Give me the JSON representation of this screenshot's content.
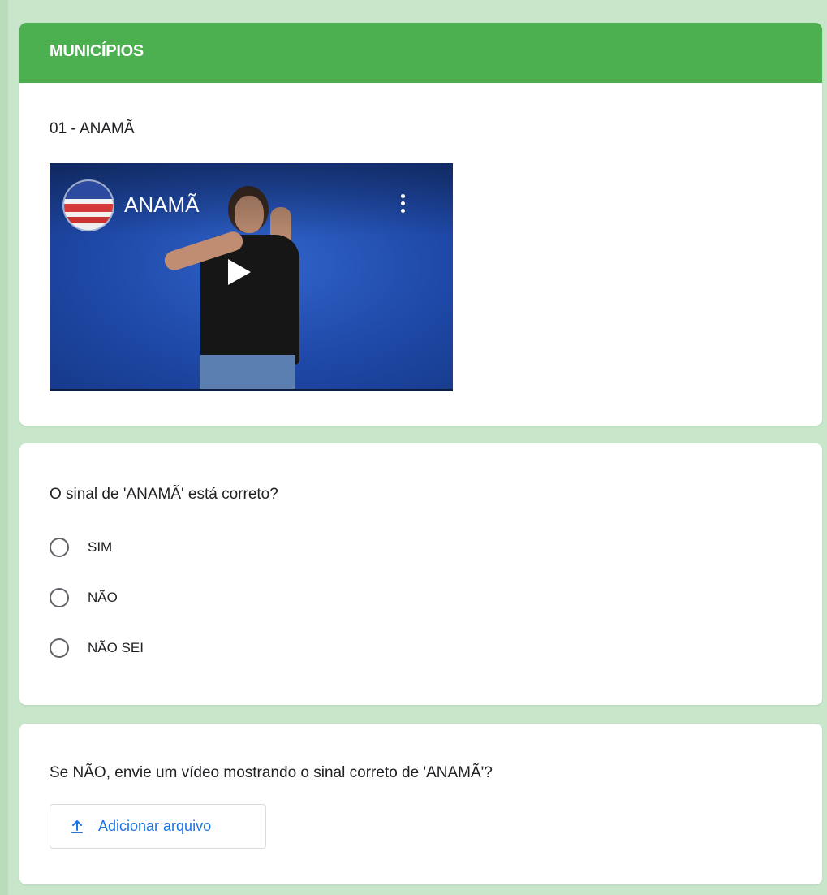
{
  "section": {
    "title": "MUNICÍPIOS",
    "item_title": "01 - ANAMÃ",
    "video": {
      "title": "ANAMÃ"
    }
  },
  "question": {
    "text": "O sinal de 'ANAMÃ' está correto?",
    "options": [
      {
        "label": "SIM",
        "selected": false
      },
      {
        "label": "NÃO",
        "selected": false
      },
      {
        "label": "NÃO SEI",
        "selected": false
      }
    ]
  },
  "upload": {
    "question": "Se NÃO, envie um vídeo mostrando o sinal correto de 'ANAMÃ'?",
    "button_label": "Adicionar arquivo",
    "button_icon": "upload-icon"
  },
  "colors": {
    "header": "#4caf50",
    "background": "#c8e6c9",
    "link": "#1a73e8"
  }
}
